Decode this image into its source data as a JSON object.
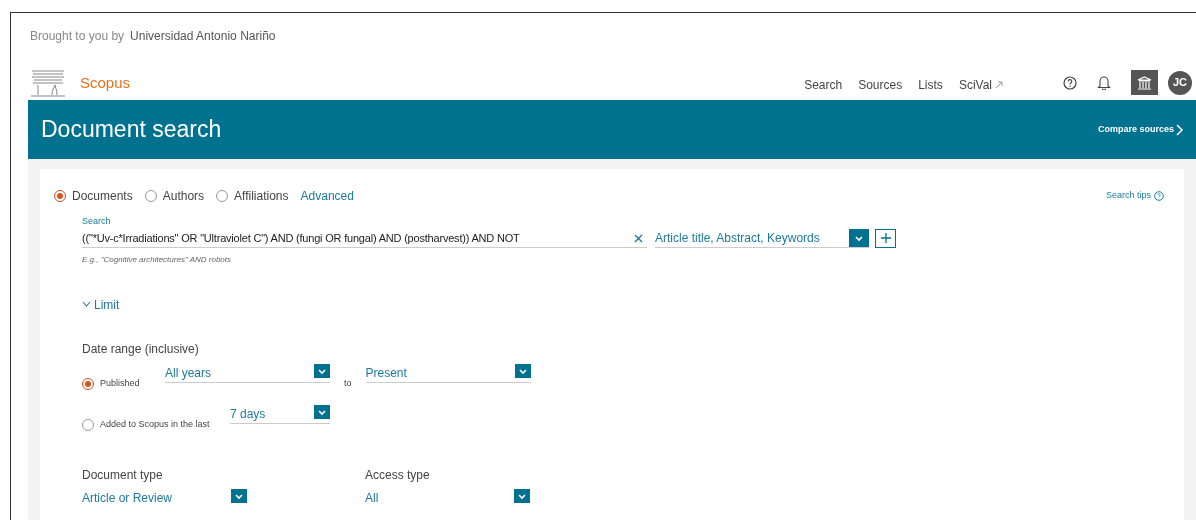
{
  "top_bar": {
    "prefix": "Brought to you by",
    "institution": "Universidad Antonio Nariño"
  },
  "header": {
    "brand": "Scopus",
    "nav": [
      {
        "label": "Search",
        "external": false
      },
      {
        "label": "Sources",
        "external": false
      },
      {
        "label": "Lists",
        "external": false
      },
      {
        "label": "SciVal",
        "external": true
      }
    ],
    "avatar": "JC"
  },
  "banner": {
    "title": "Document search",
    "link": "Compare sources"
  },
  "search_types": [
    {
      "label": "Documents",
      "selected": true
    },
    {
      "label": "Authors",
      "selected": false
    },
    {
      "label": "Affiliations",
      "selected": false
    }
  ],
  "advanced_link": "Advanced",
  "search_tips": "Search tips",
  "search": {
    "label": "Search",
    "value": "((\"*Uv-c*Irradiations\" OR \"Ultraviolet C\") AND (fungi OR fungal) AND (postharvest)) AND NOT",
    "hint": "E.g., \"Cognitive architectures\" AND robots",
    "field": "Article title, Abstract, Keywords"
  },
  "limit": {
    "label": "Limit",
    "expanded": true
  },
  "date_range": {
    "title": "Date range (inclusive)",
    "options": [
      {
        "label": "Published",
        "selected": true,
        "from": "All years",
        "joiner": "to",
        "to": "Present"
      },
      {
        "label": "Added to Scopus in the last",
        "selected": false,
        "from": "7 days"
      }
    ]
  },
  "filters": [
    {
      "title": "Document type",
      "value": "Article or Review"
    },
    {
      "title": "Access type",
      "value": "All"
    }
  ]
}
